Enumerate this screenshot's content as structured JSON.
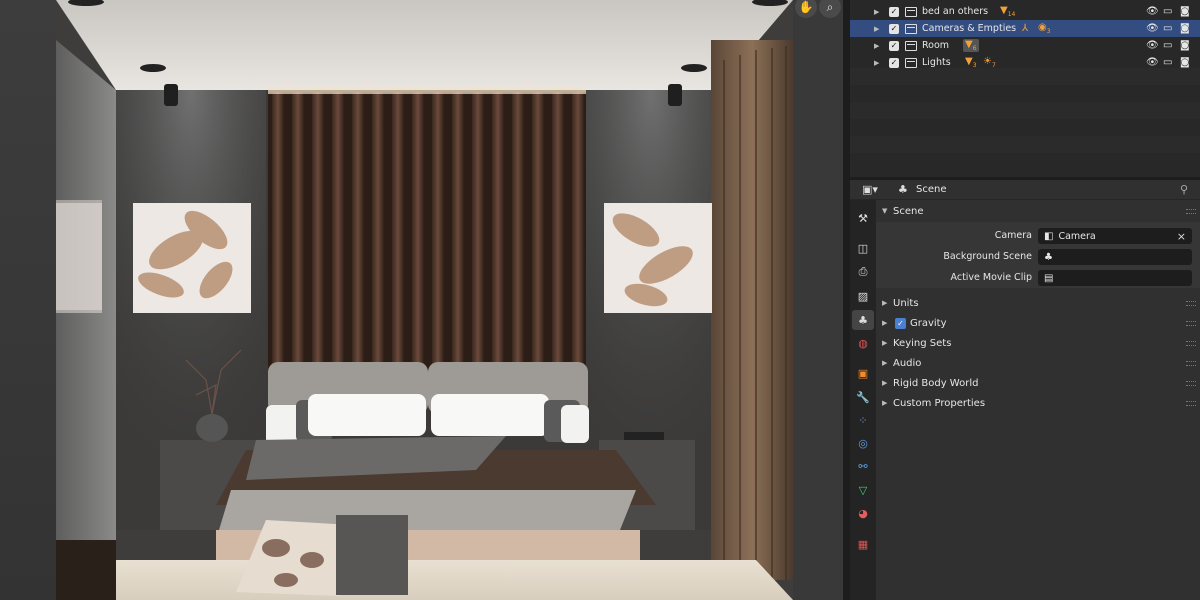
{
  "viewport": {
    "nav_hand_icon": "hand-icon",
    "nav_zoom_icon": "zoom-icon"
  },
  "outliner": {
    "rows": [
      {
        "label": "bed an others",
        "badge_count": "14",
        "selected": false
      },
      {
        "label": "Cameras & Empties",
        "badge_count": "3",
        "selected": true
      },
      {
        "label": "Room",
        "badge_count": "6",
        "selected": false
      },
      {
        "label": "Lights",
        "badge_count": "3",
        "badge2_count": "7",
        "selected": false
      }
    ]
  },
  "properties": {
    "header_title": "Scene",
    "panels": {
      "scene": {
        "title": "Scene",
        "camera_label": "Camera",
        "camera_value": "Camera",
        "background_scene_label": "Background Scene",
        "background_scene_value": "",
        "active_movie_clip_label": "Active Movie Clip",
        "active_movie_clip_value": ""
      },
      "units": "Units",
      "gravity": "Gravity",
      "keying_sets": "Keying Sets",
      "audio": "Audio",
      "rigid_body_world": "Rigid Body World",
      "custom_properties": "Custom Properties"
    }
  },
  "colors": {
    "selection": "#334d80",
    "accent_orange": "#f0a13b",
    "checkbox_blue": "#4a7fd1"
  }
}
